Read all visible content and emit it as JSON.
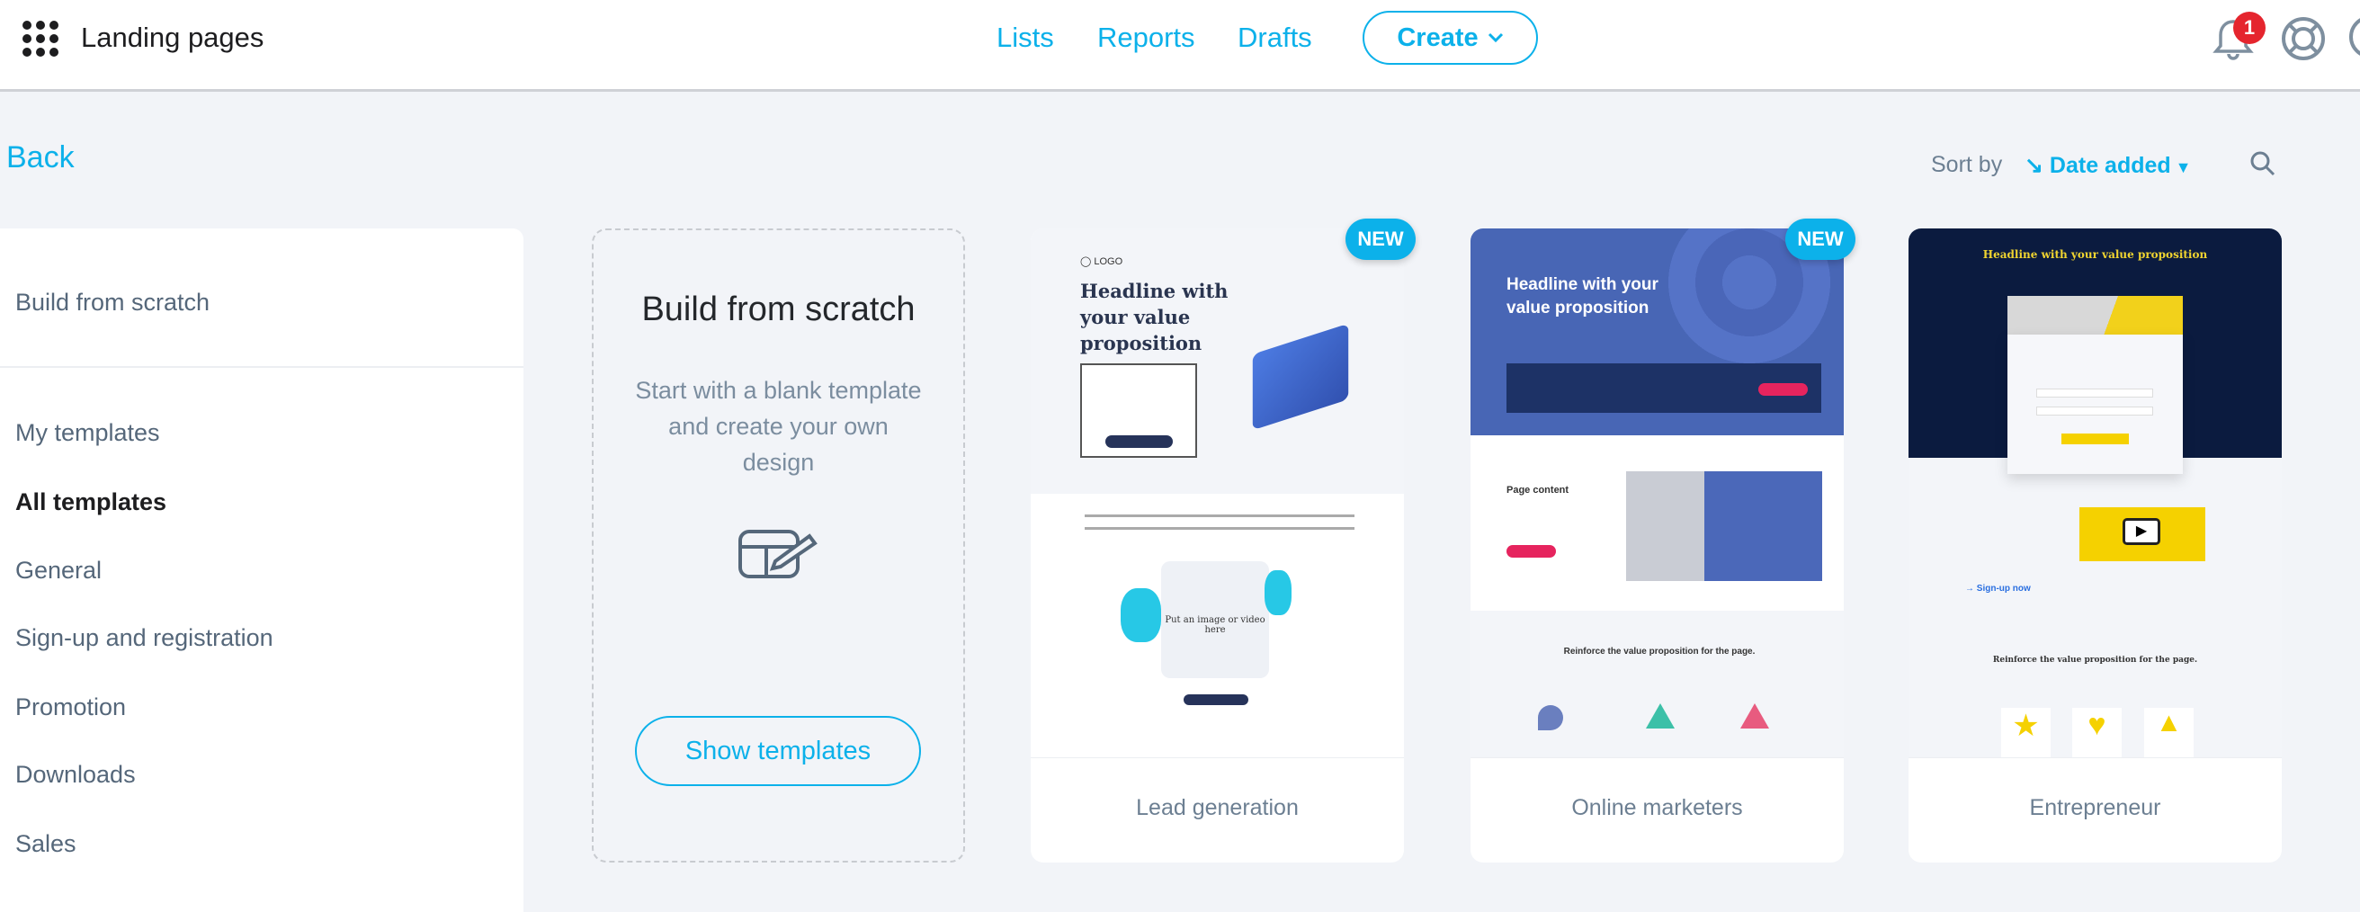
{
  "header": {
    "title": "Landing pages",
    "nav": [
      "Lists",
      "Reports",
      "Drafts"
    ],
    "create_label": "Create",
    "notification_count": "1",
    "accent": "#0cb1ea"
  },
  "toolbar": {
    "back_label": "Back",
    "sort_label": "Sort by",
    "sort_value": "Date added"
  },
  "sidebar": {
    "top_item": "Build from scratch",
    "items": [
      "My templates",
      "All templates",
      "General",
      "Sign-up and registration",
      "Promotion",
      "Downloads",
      "Sales"
    ],
    "active": "All templates"
  },
  "scratch_card": {
    "title": "Build from scratch",
    "description": "Start with a blank template and create your own design",
    "button": "Show templates"
  },
  "templates": [
    {
      "name": "Lead generation",
      "badge": "NEW",
      "headline": "Headline with your value proposition",
      "image_text": "Put an image or video here"
    },
    {
      "name": "Online marketers",
      "badge": "NEW",
      "headline": "Headline with your value proposition",
      "section": "Page content",
      "reinforce": "Reinforce the value proposition for the page."
    },
    {
      "name": "Entrepreneur",
      "headline": "Headline with your value proposition",
      "reinforce": "Reinforce the value proposition for the page.",
      "cta": "→ Sign-up now"
    }
  ]
}
